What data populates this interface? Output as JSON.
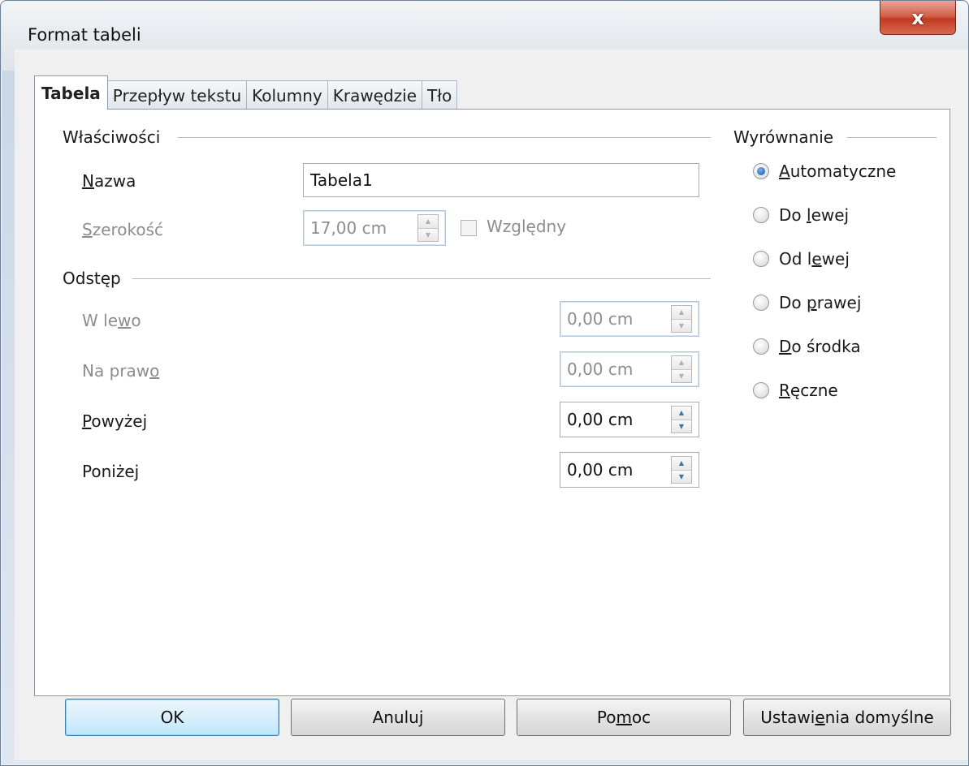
{
  "window": {
    "title": "Format tabeli",
    "close_label": "x"
  },
  "tabs": [
    {
      "label": "Tabela",
      "active": true
    },
    {
      "label": "Przepływ tekstu",
      "active": false
    },
    {
      "label": "Kolumny",
      "active": false
    },
    {
      "label": "Krawędzie",
      "active": false
    },
    {
      "label": "Tło",
      "active": false
    }
  ],
  "properties": {
    "group_label": "Właściwości",
    "name_label": "Nazwa",
    "name_value": "Tabela1",
    "width_label": "Szerokość",
    "width_value": "17,00 cm",
    "relative_label": "Względny"
  },
  "spacing": {
    "group_label": "Odstęp",
    "left_label": "W lewo",
    "left_value": "0,00 cm",
    "right_label": "Na prawo",
    "right_value": "0,00 cm",
    "above_label": "Powyżej",
    "above_value": "0,00 cm",
    "below_label": "Poniżej",
    "below_value": "0,00 cm"
  },
  "alignment": {
    "group_label": "Wyrównanie",
    "options": [
      {
        "label": "Automatyczne",
        "checked": true
      },
      {
        "label": "Do lewej",
        "checked": false
      },
      {
        "label": "Od lewej",
        "checked": false
      },
      {
        "label": "Do prawej",
        "checked": false
      },
      {
        "label": "Do środka",
        "checked": false
      },
      {
        "label": "Ręczne",
        "checked": false
      }
    ]
  },
  "buttons": {
    "ok": "OK",
    "cancel": "Anuluj",
    "help": "Pomoc",
    "reset": "Ustawienia domyślne"
  }
}
